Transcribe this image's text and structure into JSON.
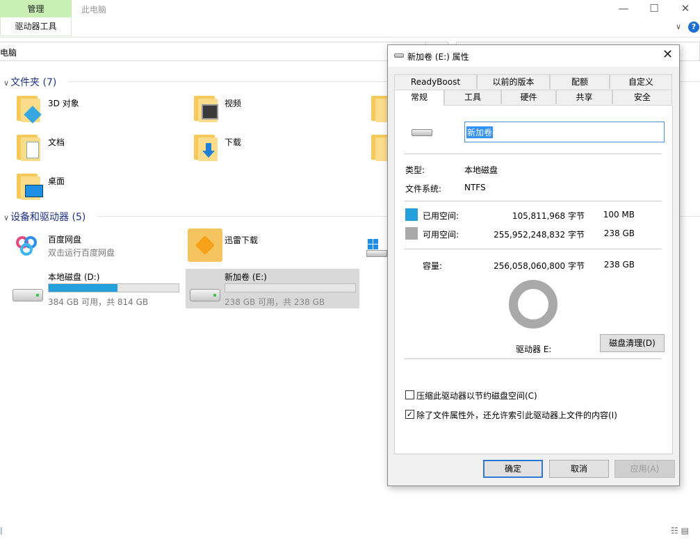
{
  "ribbon": {
    "tab_manage": "管理",
    "tab_this_pc": "此电脑",
    "drive_tools": "驱动器工具",
    "minimize": "—",
    "maximize": "☐",
    "close": "✕",
    "expand": "∨",
    "help": "?"
  },
  "address": {
    "text": "电脑"
  },
  "folders_group": {
    "arrow": "∨",
    "header": "文件夹 (7)",
    "items": [
      {
        "label": "3D 对象",
        "icon": "3d-objects-icon"
      },
      {
        "label": "视频",
        "icon": "videos-icon"
      },
      {
        "label": "文档",
        "icon": "documents-icon"
      },
      {
        "label": "下载",
        "icon": "downloads-icon"
      },
      {
        "label": "桌面",
        "icon": "desktop-icon"
      }
    ]
  },
  "drives_group": {
    "arrow": "∨",
    "header": "设备和驱动器 (5)",
    "items": [
      {
        "label": "百度网盘",
        "sub": "双击运行百度网盘"
      },
      {
        "label": "迅雷下载",
        "sub": ""
      },
      {
        "label": "本地磁盘 (D:)",
        "sub": "384 GB 可用，共 814 GB",
        "used_fraction": 0.53
      },
      {
        "label": "新加卷 (E:)",
        "sub": "238 GB 可用，共 238 GB",
        "used_fraction": 0.0
      }
    ]
  },
  "status": {
    "left": "|",
    "right": "☷ ▤"
  },
  "dialog": {
    "title": "新加卷 (E:) 属性",
    "close": "✕",
    "tabs_row1": [
      "ReadyBoost",
      "以前的版本",
      "配额",
      "自定义"
    ],
    "tabs_row2": [
      "常规",
      "工具",
      "硬件",
      "共享",
      "安全"
    ],
    "volume_name": "新加卷",
    "type_label": "类型:",
    "type_value": "本地磁盘",
    "fs_label": "文件系统:",
    "fs_value": "NTFS",
    "used_label": "已用空间:",
    "used_bytes": "105,811,968 字节",
    "used_size": "100 MB",
    "free_label": "可用空间:",
    "free_bytes": "255,952,248,832 字节",
    "free_size": "238 GB",
    "capacity_label": "容量:",
    "capacity_bytes": "256,058,060,800 字节",
    "capacity_size": "238 GB",
    "drive_label": "驱动器 E:",
    "cleanup_button": "磁盘清理(D)",
    "compress_label": "压缩此驱动器以节约磁盘空间(C)",
    "compress_checked": false,
    "index_label": "除了文件属性外，还允许索引此驱动器上文件的内容(I)",
    "index_checked": true,
    "check_mark": "✓",
    "ok": "确定",
    "cancel": "取消",
    "apply": "应用(A)",
    "colors": {
      "used": "#26a0da",
      "free": "#a9a9a9"
    }
  }
}
